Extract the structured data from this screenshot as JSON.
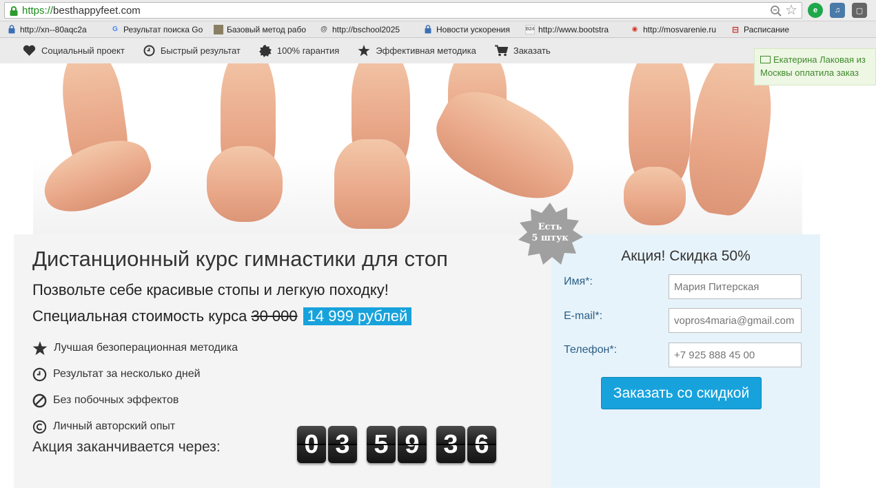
{
  "browser": {
    "url_scheme": "https://",
    "url_host": "besthappyfeet.com",
    "bookmarks": [
      {
        "label": "http://xn--80aqc2a",
        "icon": "lock-icon"
      },
      {
        "label": "Результат поиска Go",
        "icon": "google-icon"
      },
      {
        "label": "Базовый метод рабо",
        "icon": "photo-icon"
      },
      {
        "label": "http://bschool2025",
        "icon": "swirl-icon"
      },
      {
        "label": "Новости ускорения",
        "icon": "lock-icon"
      },
      {
        "label": "http://www.bootstra",
        "icon": "b24-icon"
      },
      {
        "label": "http://mosvarenie.ru",
        "icon": "owl-icon"
      },
      {
        "label": "Расписание",
        "icon": "schedule-icon"
      }
    ]
  },
  "nav": {
    "items": [
      {
        "label": "Социальный проект",
        "icon": "heart-icon"
      },
      {
        "label": "Быстрый результат",
        "icon": "clock-icon"
      },
      {
        "label": "100% гарантия",
        "icon": "seal-icon"
      },
      {
        "label": "Эффективная методика",
        "icon": "star-icon"
      },
      {
        "label": "Заказать",
        "icon": "cart-icon"
      }
    ]
  },
  "notification": {
    "text": "Екатерина Лаковая из Москвы оплатила заказ"
  },
  "badge": {
    "line1": "Есть",
    "line2": "5 штук"
  },
  "main": {
    "title": "Дистанционный курс гимнастики для стоп",
    "subtitle": "Позвольте себе красивые стопы и легкую походку!",
    "price_label": "Специальная стоимость курса",
    "old_price": "30 000",
    "new_price": "14 999 рублей",
    "features": [
      {
        "label": "Лучшая безоперационная методика",
        "icon": "star-icon"
      },
      {
        "label": "Результат за несколько дней",
        "icon": "clock-icon"
      },
      {
        "label": "Без побочных эффектов",
        "icon": "no-icon"
      },
      {
        "label": "Личный авторский опыт",
        "icon": "copyright-icon"
      }
    ],
    "countdown_label": "Акция заканчивается через:",
    "countdown": {
      "hours": "03",
      "minutes": "59",
      "seconds": "36"
    }
  },
  "form": {
    "title": "Акция! Скидка 50%",
    "name_label": "Имя*:",
    "name_placeholder": "Мария Питерская",
    "email_label": "E-mail*:",
    "email_placeholder": "vopros4maria@gmail.com",
    "phone_label": "Телефон*:",
    "phone_placeholder": "+7 925 888 45 00",
    "submit_label": "Заказать со скидкой"
  },
  "colors": {
    "accent": "#17a2dc",
    "notify_green": "#3c8a2a",
    "form_bg": "#e7f3fb"
  }
}
